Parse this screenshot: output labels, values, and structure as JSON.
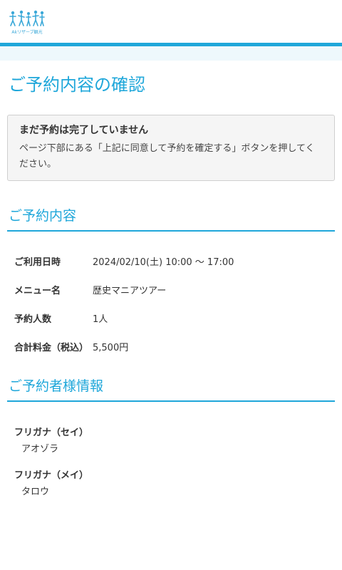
{
  "header": {
    "logo_text": "Akリザーブ観光"
  },
  "page": {
    "title": "ご予約内容の確認"
  },
  "notice": {
    "title": "まだ予約は完了していません",
    "body": "ページ下部にある「上記に同意して予約を確定する」ボタンを押してください。"
  },
  "reservation": {
    "section_title": "ご予約内容",
    "rows": [
      {
        "label": "ご利用日時",
        "value": "2024/02/10(土) 10:00 〜 17:00"
      },
      {
        "label": "メニュー名",
        "value": "歴史マニアツアー"
      },
      {
        "label": "予約人数",
        "value": "1人"
      },
      {
        "label": "合計料金（税込）",
        "value": "5,500円"
      }
    ]
  },
  "customer": {
    "section_title": "ご予約者様情報",
    "fields": [
      {
        "label": "フリガナ（セイ）",
        "value": "アオゾラ"
      },
      {
        "label": "フリガナ（メイ）",
        "value": "タロウ"
      }
    ]
  },
  "colors": {
    "accent": "#1fa7da",
    "notice_bg": "#f5f5f5"
  }
}
